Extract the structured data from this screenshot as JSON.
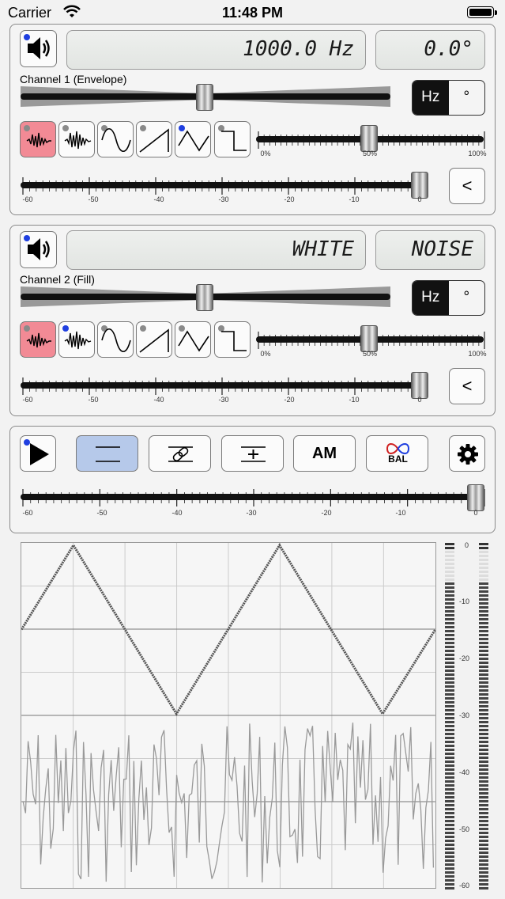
{
  "status_bar": {
    "carrier": "Carrier",
    "time": "11:48 PM"
  },
  "channel1": {
    "label": "Channel 1 (Envelope)",
    "frequency": "1000.0 Hz",
    "phase": "0.0°",
    "unit_options": [
      "Hz",
      "°"
    ],
    "selected_unit": "Hz",
    "duty_ticks": [
      "0%",
      "50%",
      "100%"
    ],
    "level_ticks": [
      "-60",
      "-50",
      "-40",
      "-30",
      "-20",
      "-10",
      "0"
    ],
    "collapse_label": "<",
    "selected_waveform": "noise-pink"
  },
  "channel2": {
    "label": "Channel 2 (Fill)",
    "frequency": "WHITE",
    "phase": "NOISE",
    "unit_options": [
      "Hz",
      "°"
    ],
    "selected_unit": "Hz",
    "duty_ticks": [
      "0%",
      "50%",
      "100%"
    ],
    "level_ticks": [
      "-60",
      "-50",
      "-40",
      "-30",
      "-20",
      "-10",
      "0"
    ],
    "collapse_label": "<",
    "selected_waveform": "noise-pink"
  },
  "master": {
    "am_label": "AM",
    "bal_label": "BAL",
    "level_ticks": [
      "-60",
      "-50",
      "-40",
      "-30",
      "-20",
      "-10",
      "0"
    ]
  },
  "meter": {
    "ticks": [
      "0",
      "-10",
      "-20",
      "-30",
      "-40",
      "-50",
      "-60"
    ]
  },
  "colors": {
    "selected_wave": "#f28a95",
    "selected_mode": "#b6c9ea",
    "indicator": "#1f3fe0"
  }
}
